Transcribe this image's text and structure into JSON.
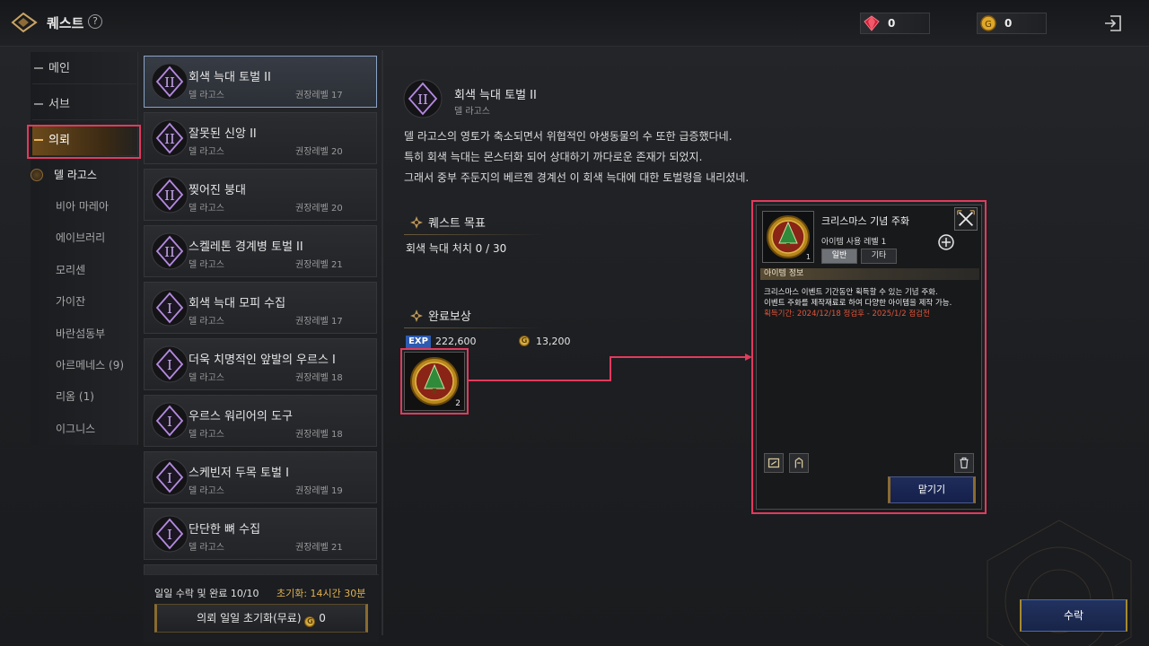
{
  "header": {
    "title": "퀘스트",
    "help": "?",
    "currency": [
      {
        "name": "gem",
        "value": "0",
        "color": "#d2213a"
      },
      {
        "name": "gold",
        "value": "0",
        "color": "#e0a82a"
      }
    ]
  },
  "nav": {
    "major": [
      {
        "label": "메인"
      },
      {
        "label": "서브"
      },
      {
        "label": "의뢰",
        "active": true
      }
    ],
    "sub": [
      {
        "label": "델 라고스",
        "current": true
      },
      {
        "label": "비아 마레아"
      },
      {
        "label": "에이브러리"
      },
      {
        "label": "모리센"
      },
      {
        "label": "가이잔"
      },
      {
        "label": "바란섬동부"
      },
      {
        "label": "아르메네스 (9)"
      },
      {
        "label": "리옴 (1)"
      },
      {
        "label": "이그니스"
      }
    ]
  },
  "quests": [
    {
      "name": "회색 늑대 토벌 II",
      "region": "델 라고스",
      "level": "권장레벨 17",
      "tier": "II"
    },
    {
      "name": "잘못된 신앙 II",
      "region": "델 라고스",
      "level": "권장레벨 20",
      "tier": "II"
    },
    {
      "name": "찢어진 붕대",
      "region": "델 라고스",
      "level": "권장레벨 20",
      "tier": "II"
    },
    {
      "name": "스켈레톤 경계병 토벌 II",
      "region": "델 라고스",
      "level": "권장레벨 21",
      "tier": "II"
    },
    {
      "name": "회색 늑대 모피 수집",
      "region": "델 라고스",
      "level": "권장레벨 17",
      "tier": "I"
    },
    {
      "name": "더욱 치명적인 앞발의 우르스 I",
      "region": "델 라고스",
      "level": "권장레벨 18",
      "tier": "I"
    },
    {
      "name": "우르스 워리어의 도구",
      "region": "델 라고스",
      "level": "권장레벨 18",
      "tier": "I"
    },
    {
      "name": "스케빈저 두목 토벌 I",
      "region": "델 라고스",
      "level": "권장레벨 19",
      "tier": "I"
    },
    {
      "name": "단단한 뼈 수집",
      "region": "델 라고스",
      "level": "권장레벨 21",
      "tier": "I"
    }
  ],
  "list_footer": {
    "daily": "일일 수락 및 완료 10/10",
    "reset": "초기화: 14시간 30분",
    "reset_button": "의뢰 일일 초기화(무료)",
    "reset_cost": "0"
  },
  "detail": {
    "tier": "II",
    "title": "회색 늑대 토벌 II",
    "region": "델 라고스",
    "description": [
      "델 라고스의 영토가 축소되면서 위협적인 야생동물의 수 또한 급증했다네.",
      "특히 회색 늑대는 몬스터화 되어 상대하기 까다로운 존재가 되었지.",
      "그래서 중부 주둔지의 베르젠 경계선 이 회색 늑대에 대한 토벌령을 내리셨네."
    ],
    "goal_header": "퀘스트 목표",
    "goal": "회색 늑대 처치 0 / 30",
    "reward_header": "완료보상",
    "exp_label": "EXP",
    "exp": "222,600",
    "gold": "13,200",
    "reward_count": "2"
  },
  "tooltip": {
    "name": "크리스마스 기념 주화",
    "level_label": "아이템 사용 레벨",
    "level": "1",
    "tabs": [
      "일반",
      "기타"
    ],
    "info_header": "아이템 정보",
    "lines": [
      "크리스마스 이벤트 기간동안 획득할 수 있는 기념 주화.",
      "이벤트 주화를 제작재료로 하여 다양한 아이템을 제작 가능."
    ],
    "period": "획득기간: 2024/12/18 정검후 - 2025/1/2 점검전",
    "slot_count": "1",
    "keep_button": "맡기기"
  },
  "accept_button": "수락",
  "colors": {
    "highlight": "#e23a5c",
    "quest_icon": "#b48ae0",
    "exp": "#2e5bb0"
  }
}
